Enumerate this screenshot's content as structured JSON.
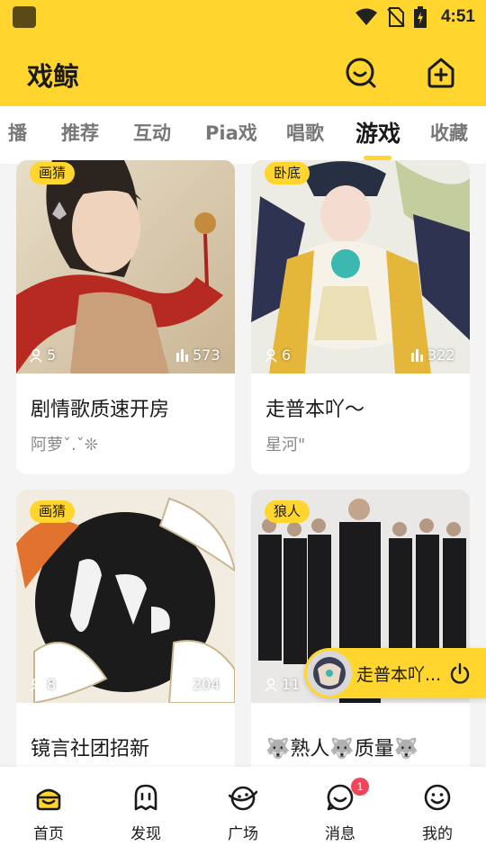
{
  "status_bar": {
    "time": "4:51"
  },
  "app": {
    "title": "戏鲸",
    "icons": [
      "search-smile-icon",
      "create-room-icon"
    ]
  },
  "tabs": [
    {
      "label": "播",
      "active": false
    },
    {
      "label": "推荐",
      "active": false
    },
    {
      "label": "互动",
      "active": false
    },
    {
      "label": "Pia戏",
      "active": false
    },
    {
      "label": "唱歌",
      "active": false
    },
    {
      "label": "游戏",
      "active": true
    },
    {
      "label": "收藏",
      "active": false
    }
  ],
  "rooms": [
    {
      "tag": "画猜",
      "members": "5",
      "plays": "573",
      "title": "剧情歌质速开房",
      "host": "阿萝ˇ.ˇ❊"
    },
    {
      "tag": "卧底",
      "members": "6",
      "plays": "322",
      "title": "走普本吖～",
      "host": "星河\""
    },
    {
      "tag": "画猜",
      "members": "8",
      "plays": "204",
      "title": "镜言社团招新",
      "host": ""
    },
    {
      "tag": "狼人",
      "members": "11",
      "plays": "196",
      "title": "🐺熟人🐺质量🐺",
      "host": ""
    }
  ],
  "mini_player": {
    "title": "走普本吖..."
  },
  "bottom_nav": [
    {
      "label": "首页",
      "icon": "home-icon",
      "active": true
    },
    {
      "label": "发现",
      "icon": "discover-icon",
      "active": false
    },
    {
      "label": "广场",
      "icon": "square-icon",
      "active": false
    },
    {
      "label": "消息",
      "icon": "message-icon",
      "active": false,
      "badge": "1"
    },
    {
      "label": "我的",
      "icon": "profile-icon",
      "active": false
    }
  ],
  "colors": {
    "accent": "#FFD52E",
    "badge": "#f0455b"
  }
}
